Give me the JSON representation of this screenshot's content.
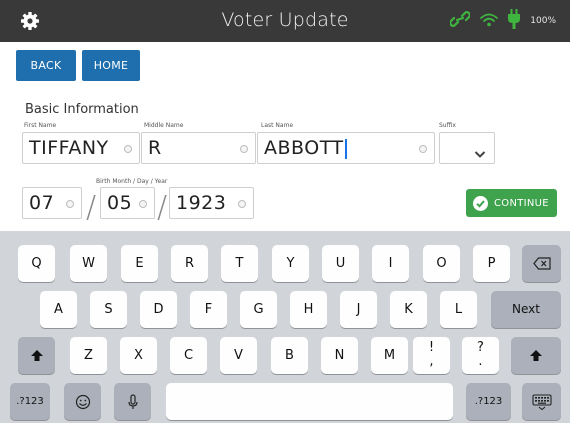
{
  "titlebar": {
    "title": "Voter Update",
    "battery_text": "100%",
    "icons": [
      "gear-icon",
      "link-icon",
      "wifi-icon",
      "plug-icon"
    ]
  },
  "nav": {
    "back_label": "BACK",
    "home_label": "HOME"
  },
  "section_title": "Basic Information",
  "fields": {
    "first_name": {
      "label": "First Name",
      "value": "TIFFANY"
    },
    "middle_name": {
      "label": "Middle Name",
      "value": "R"
    },
    "last_name": {
      "label": "Last Name",
      "value": "ABBOTT"
    },
    "suffix": {
      "label": "Suffix",
      "value": ""
    }
  },
  "birth": {
    "label": "Birth Month / Day / Year",
    "month": "07",
    "day": "05",
    "year": "1923",
    "separator": "/"
  },
  "continue_label": "CONTINUE",
  "colors": {
    "titlebar": "#393939",
    "nav_button": "#1f6fae",
    "continue": "#3fa34d",
    "caret": "#1a73e8",
    "keyboard_bg": "#d1d4d9"
  },
  "keyboard": {
    "row1": [
      "Q",
      "W",
      "E",
      "R",
      "T",
      "Y",
      "U",
      "I",
      "O",
      "P"
    ],
    "row2": [
      "A",
      "S",
      "D",
      "F",
      "G",
      "H",
      "J",
      "K",
      "L"
    ],
    "row3": [
      "Z",
      "X",
      "C",
      "V",
      "B",
      "N",
      "M"
    ],
    "next_label": "Next",
    "punct1_top": "!",
    "punct1_bottom": ",",
    "punct2_top": "?",
    "punct2_bottom": ".",
    "mode_left": ".?123",
    "mode_right": ".?123"
  }
}
